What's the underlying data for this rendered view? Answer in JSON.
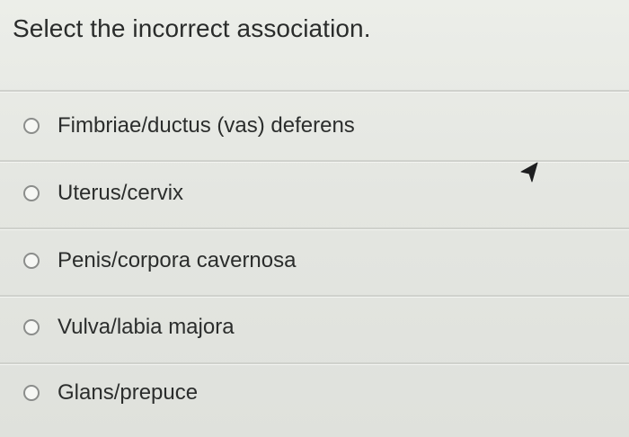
{
  "question": {
    "prompt": "Select the incorrect association."
  },
  "options": [
    {
      "label": "Fimbriae/ductus (vas) deferens",
      "selected": false
    },
    {
      "label": "Uterus/cervix",
      "selected": false
    },
    {
      "label": "Penis/corpora cavernosa",
      "selected": false
    },
    {
      "label": "Vulva/labia majora",
      "selected": false
    },
    {
      "label": "Glans/prepuce",
      "selected": false
    }
  ],
  "icons": {
    "cursor": "mouse-pointer-icon",
    "radio": "radio-button-icon"
  },
  "colors": {
    "background": "#e6e8e3",
    "text": "#2b2d2c",
    "radio_border": "#8b8d8b",
    "divider": "#cfd1cc"
  }
}
